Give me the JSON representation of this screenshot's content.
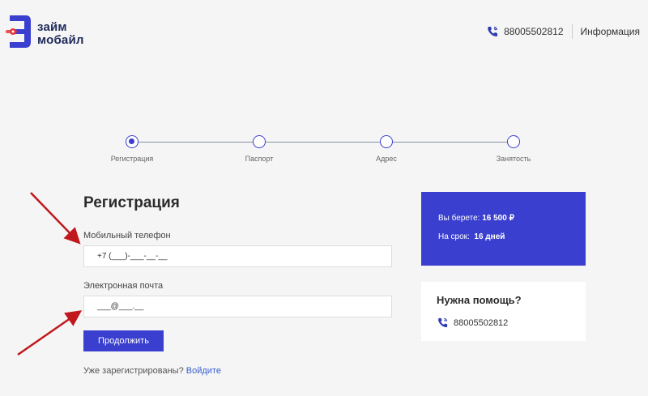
{
  "header": {
    "logo_line1": "займ",
    "logo_line2": "мобайл",
    "phone": "88005502812",
    "info_link": "Информация"
  },
  "stepper": {
    "steps": [
      {
        "label": "Регистрация",
        "active": true
      },
      {
        "label": "Паспорт",
        "active": false
      },
      {
        "label": "Адрес",
        "active": false
      },
      {
        "label": "Занятость",
        "active": false
      }
    ]
  },
  "form": {
    "title": "Регистрация",
    "phone_label": "Мобильный телефон",
    "phone_value": "+7 (___)-___-__-__",
    "email_label": "Электронная почта",
    "email_value": "___@___.__",
    "submit": "Продолжить",
    "login_prompt": "Уже зарегистрированы?",
    "login_link": "Войдите"
  },
  "offer": {
    "amount_label": "Вы берете:",
    "amount_value": "16 500 ₽",
    "term_label": "На срок:",
    "term_value": "16 дней"
  },
  "help": {
    "title": "Нужна помощь?",
    "phone": "88005502812"
  },
  "colors": {
    "accent": "#3a3fcf",
    "background": "#f5f5f5",
    "annotation_arrow": "#c0181c"
  }
}
